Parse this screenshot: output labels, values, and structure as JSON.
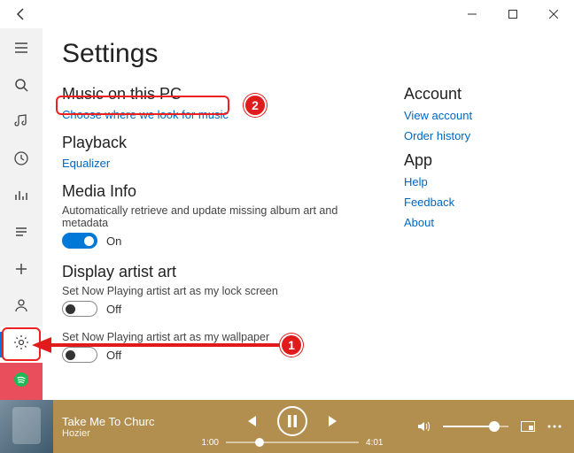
{
  "page_title": "Settings",
  "sections": {
    "music_on_pc": {
      "heading": "Music on this PC",
      "link": "Choose where we look for music"
    },
    "playback": {
      "heading": "Playback",
      "link": "Equalizer"
    },
    "media_info": {
      "heading": "Media Info",
      "desc": "Automatically retrieve and update missing album art and metadata",
      "toggle_label": "On"
    },
    "display_artist": {
      "heading": "Display artist art",
      "lock_desc": "Set Now Playing artist art as my lock screen",
      "lock_label": "Off",
      "wall_desc": "Set Now Playing artist art as my wallpaper",
      "wall_label": "Off"
    }
  },
  "right_panel": {
    "account_h": "Account",
    "view_account": "View account",
    "order_history": "Order history",
    "app_h": "App",
    "help": "Help",
    "feedback": "Feedback",
    "about": "About"
  },
  "badges": {
    "one": "1",
    "two": "2"
  },
  "player": {
    "track": "Take Me To Churc",
    "artist": "Hozier",
    "elapsed": "1:00",
    "total": "4:01",
    "progress_pct": 25,
    "volume_pct": 78
  }
}
